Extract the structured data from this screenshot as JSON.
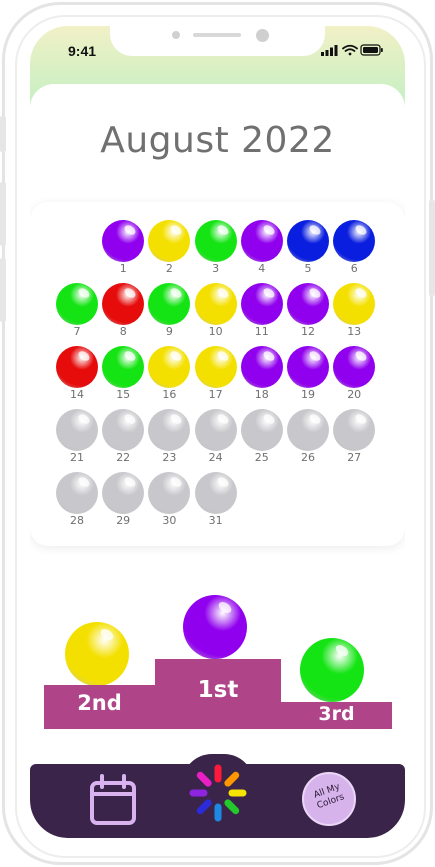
{
  "status_bar": {
    "time": "9:41"
  },
  "month_title": "August 2022",
  "colors": {
    "purple": "#9000ee",
    "yellow": "#f4e000",
    "green": "#14e414",
    "red": "#e60c0c",
    "blue": "#0a1ee0",
    "gray": "#c8c8cc",
    "podium": "#b04489",
    "tabbar": "#3a2449"
  },
  "calendar": {
    "days": [
      {
        "label": "1",
        "color": "purple"
      },
      {
        "label": "2",
        "color": "yellow"
      },
      {
        "label": "3",
        "color": "green"
      },
      {
        "label": "4",
        "color": "purple"
      },
      {
        "label": "5",
        "color": "blue"
      },
      {
        "label": "6",
        "color": "blue"
      },
      {
        "label": "7",
        "color": "green"
      },
      {
        "label": "8",
        "color": "red"
      },
      {
        "label": "9",
        "color": "green"
      },
      {
        "label": "10",
        "color": "yellow"
      },
      {
        "label": "11",
        "color": "purple"
      },
      {
        "label": "12",
        "color": "purple"
      },
      {
        "label": "13",
        "color": "yellow"
      },
      {
        "label": "14",
        "color": "red"
      },
      {
        "label": "15",
        "color": "green"
      },
      {
        "label": "16",
        "color": "yellow"
      },
      {
        "label": "17",
        "color": "yellow"
      },
      {
        "label": "18",
        "color": "purple"
      },
      {
        "label": "19",
        "color": "purple"
      },
      {
        "label": "20",
        "color": "purple"
      },
      {
        "label": "21",
        "color": "gray"
      },
      {
        "label": "22",
        "color": "gray"
      },
      {
        "label": "23",
        "color": "gray"
      },
      {
        "label": "24",
        "color": "gray"
      },
      {
        "label": "25",
        "color": "gray"
      },
      {
        "label": "26",
        "color": "gray"
      },
      {
        "label": "27",
        "color": "gray"
      },
      {
        "label": "28",
        "color": "gray"
      },
      {
        "label": "29",
        "color": "gray"
      },
      {
        "label": "30",
        "color": "gray"
      },
      {
        "label": "31",
        "color": "gray"
      }
    ]
  },
  "podium": {
    "first": {
      "label": "1st",
      "color": "purple"
    },
    "second": {
      "label": "2nd",
      "color": "yellow"
    },
    "third": {
      "label": "3rd",
      "color": "green"
    }
  },
  "tabbar": {
    "calendar_icon": "calendar-icon",
    "center_icon": "color-wheel-icon",
    "badge_text": "All My Colors"
  }
}
